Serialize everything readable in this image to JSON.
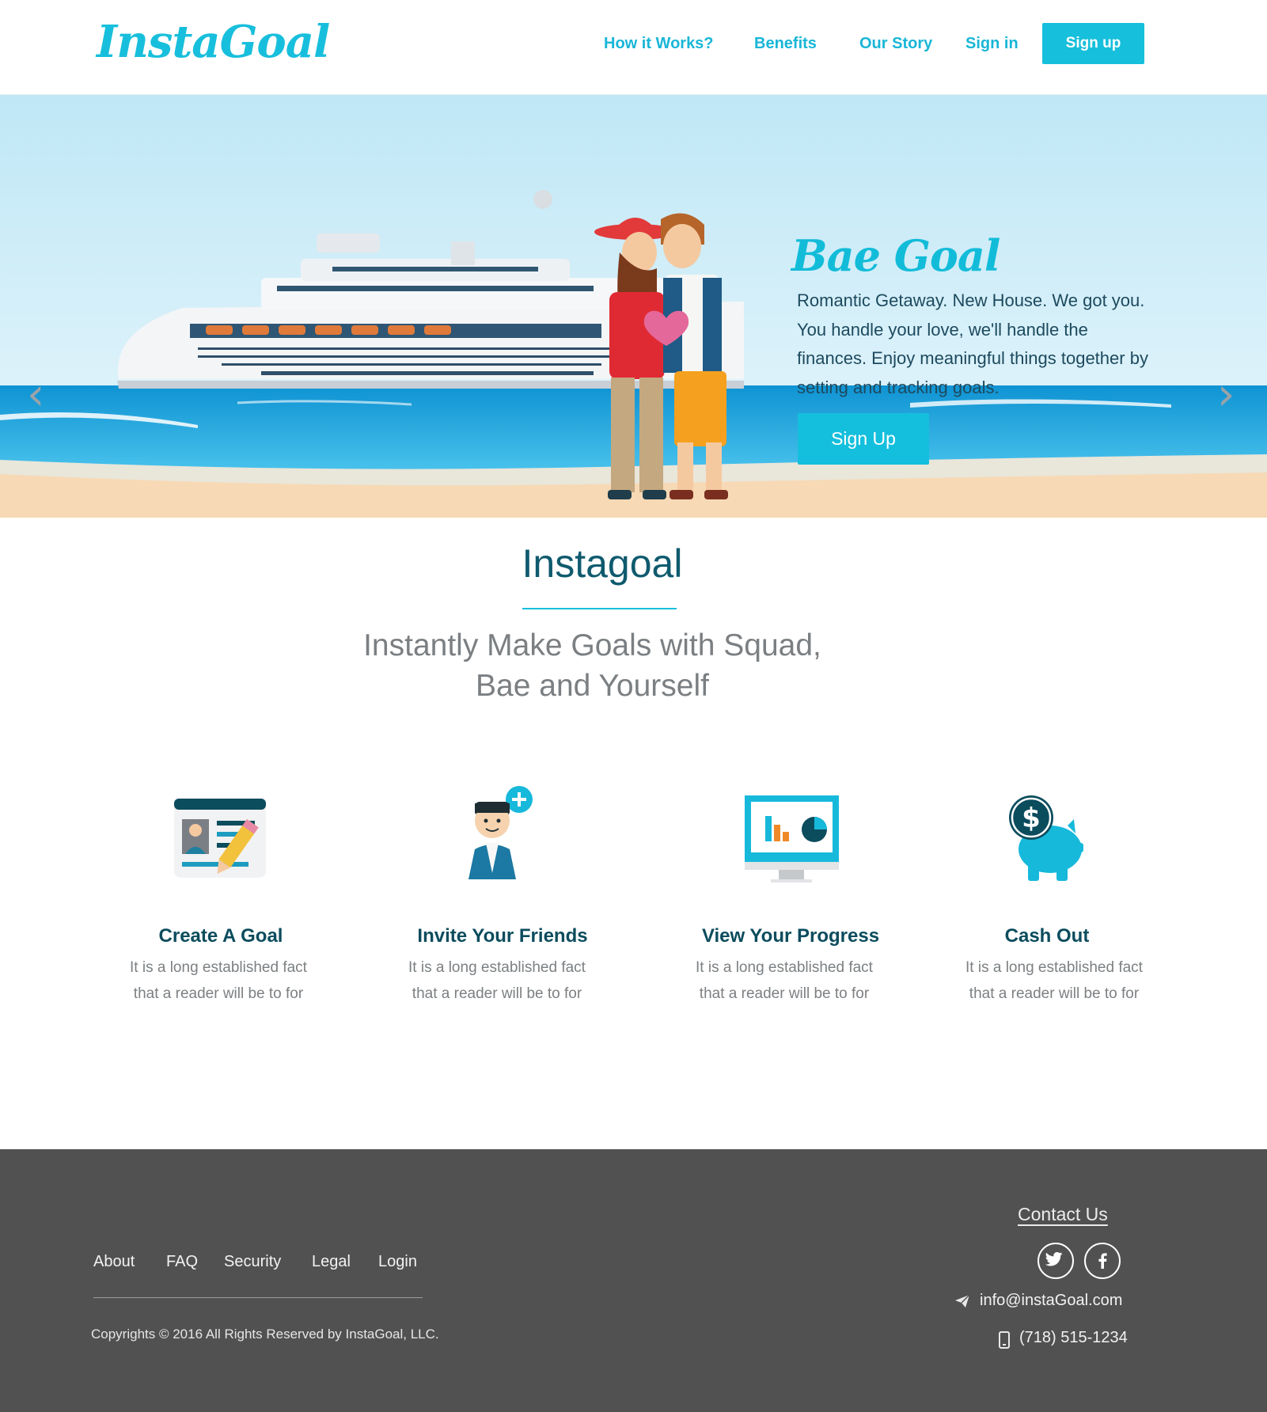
{
  "header": {
    "logo": "InstaGoal",
    "nav": [
      "How it Works?",
      "Benefits",
      "Our Story",
      "Sign in"
    ],
    "signup": "Sign up"
  },
  "hero": {
    "title": "Bae Goal",
    "text": "Romantic Getaway. New House. We got you. You handle your love, we'll handle the finances. Enjoy meaningful things together by setting and tracking goals.",
    "button": "Sign Up",
    "prev_icon": "chevron-left-icon",
    "next_icon": "chevron-right-icon"
  },
  "intro": {
    "title": "Instagoal",
    "subtitle_line1": "Instantly Make Goals with Squad,",
    "subtitle_line2": "Bae and Yourself"
  },
  "features": [
    {
      "title": "Create A Goal",
      "line1": "It is a long established fact",
      "line2": "that a reader will be to for",
      "icon": "goal-card-pencil-icon"
    },
    {
      "title": "Invite Your Friends",
      "line1": "It is a long established fact",
      "line2": "that a reader will be to for",
      "icon": "add-friend-icon"
    },
    {
      "title": "View Your Progress",
      "line1": "It is a long established fact",
      "line2": "that a reader will be to for",
      "icon": "progress-monitor-icon"
    },
    {
      "title": "Cash Out",
      "line1": "It is a long established fact",
      "line2": "that a reader will be to for",
      "icon": "piggy-bank-dollar-icon"
    }
  ],
  "footer": {
    "links": [
      "About",
      "FAQ",
      "Security",
      "Legal",
      "Login"
    ],
    "copyright": "Copyrights © 2016 All Rights Reserved by InstaGoal, LLC.",
    "contact_title": "Contact Us",
    "email": "info@instaGoal.com",
    "phone": "(718) 515-1234",
    "social_icons": [
      "twitter-icon",
      "facebook-icon"
    ]
  },
  "colors": {
    "accent": "#16bfdc",
    "dark_teal": "#0b4c5d",
    "footer_bg": "#515151"
  }
}
